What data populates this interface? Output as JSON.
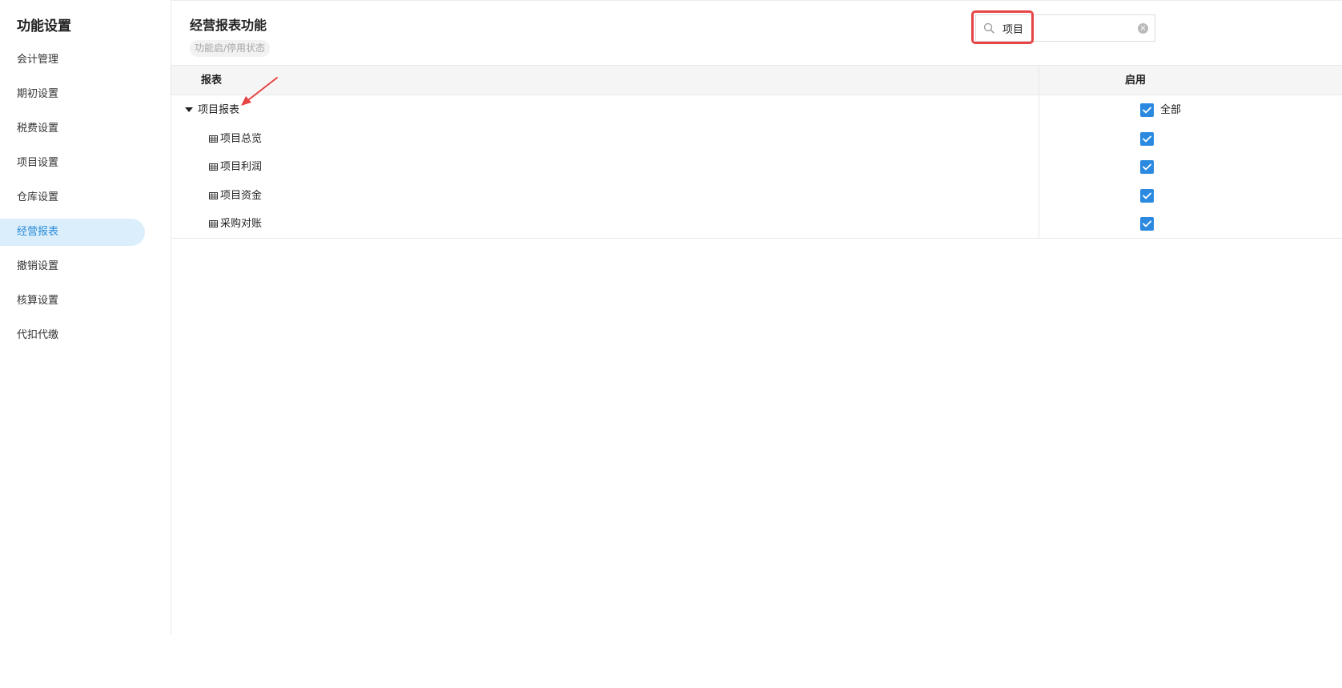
{
  "sidebar": {
    "title": "功能设置",
    "items": [
      {
        "label": "会计管理",
        "active": false
      },
      {
        "label": "期初设置",
        "active": false
      },
      {
        "label": "税费设置",
        "active": false
      },
      {
        "label": "项目设置",
        "active": false
      },
      {
        "label": "仓库设置",
        "active": false
      },
      {
        "label": "经营报表",
        "active": true
      },
      {
        "label": "撤销设置",
        "active": false
      },
      {
        "label": "核算设置",
        "active": false
      },
      {
        "label": "代扣代缴",
        "active": false
      }
    ]
  },
  "main": {
    "title": "经营报表功能",
    "status_pill": "功能启/停用状态",
    "search": {
      "value": "项目",
      "placeholder": ""
    },
    "table": {
      "headers": {
        "report": "报表",
        "enable": "启用"
      },
      "group": {
        "label": "项目报表",
        "expanded": true,
        "checked": true,
        "all_label": "全部"
      },
      "rows": [
        {
          "label": "项目总览",
          "checked": true
        },
        {
          "label": "项目利润",
          "checked": true
        },
        {
          "label": "项目资金",
          "checked": true
        },
        {
          "label": "采购对账",
          "checked": true
        }
      ]
    }
  },
  "colors": {
    "accent": "#2b8ae0",
    "active_bg": "#dbeefc",
    "active_text": "#2a8bd8",
    "highlight": "#e64545"
  },
  "icons": {
    "search": "search-icon",
    "clear": "clear-icon",
    "expand": "caret-down-icon",
    "table": "table-icon",
    "check": "check-icon"
  }
}
